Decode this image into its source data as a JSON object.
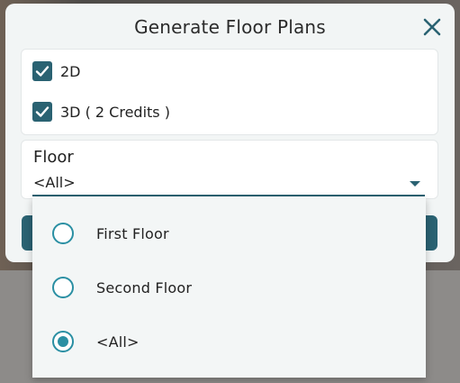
{
  "dialog": {
    "title": "Generate Floor Plans",
    "close_icon": "close-icon"
  },
  "options": {
    "type_2d": {
      "label": "2D",
      "checked": true
    },
    "type_3d": {
      "label": "3D ( 2 Credits )",
      "checked": true
    }
  },
  "floor_select": {
    "label": "Floor",
    "value": "<All>"
  },
  "floor_menu": {
    "items": [
      {
        "label": "First Floor",
        "selected": false
      },
      {
        "label": "Second Floor",
        "selected": false
      },
      {
        "label": "<All>",
        "selected": true
      }
    ]
  },
  "colors": {
    "accent": "#2a6272",
    "radio": "#2a8fa3"
  }
}
